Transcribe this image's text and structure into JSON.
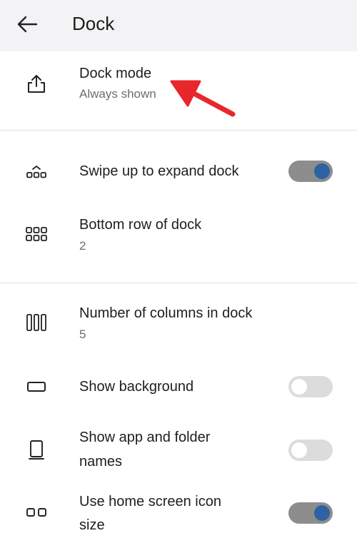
{
  "header": {
    "back_icon": "arrow-left-icon",
    "title": "Dock"
  },
  "colors": {
    "appbar_bg": "#f3f3f5",
    "toggle_on_track": "#8d8d8d",
    "toggle_on_knob": "#2e62a4",
    "toggle_off_track": "#dcdcdc",
    "annotation_arrow": "#e8262b"
  },
  "settings": {
    "dock_mode": {
      "icon": "upload-tray-icon",
      "title": "Dock mode",
      "value": "Always shown"
    },
    "swipe_up": {
      "icon": "dock-expand-icon",
      "title": "Swipe up to expand dock",
      "enabled": true
    },
    "bottom_row": {
      "icon": "grid-icon",
      "title": "Bottom row of dock",
      "value": "2"
    },
    "columns": {
      "icon": "columns-icon",
      "title": "Number of columns in dock",
      "value": "5"
    },
    "show_background": {
      "icon": "rectangle-icon",
      "title": "Show background",
      "enabled": false
    },
    "show_names": {
      "icon": "tablet-icon",
      "title_line1": "Show app and folder",
      "title_line2": "names",
      "enabled": false
    },
    "home_icon_size": {
      "icon": "two-squares-icon",
      "title_line1": "Use home screen icon",
      "title_line2": "size",
      "enabled": true
    }
  },
  "annotation": {
    "icon": "red-arrow-icon"
  }
}
